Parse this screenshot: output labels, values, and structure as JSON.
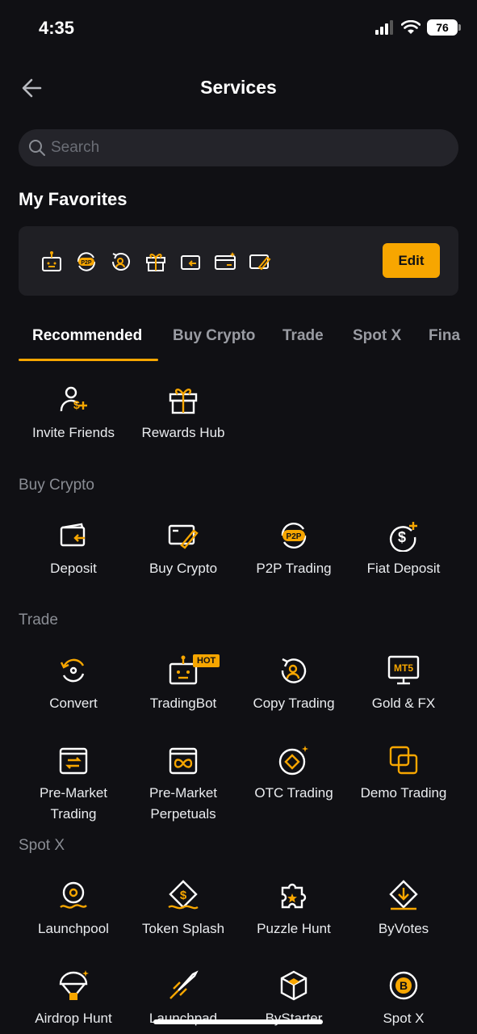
{
  "status_bar": {
    "time": "4:35",
    "battery": "76"
  },
  "header": {
    "title": "Services"
  },
  "search": {
    "placeholder": "Search"
  },
  "favorites": {
    "title": "My Favorites",
    "edit_label": "Edit",
    "icons": [
      "tradingbot-icon",
      "p2p-icon",
      "copy-trading-icon",
      "gift-icon",
      "deposit-icon",
      "card-icon",
      "buy-crypto-icon"
    ]
  },
  "tabs": [
    "Recommended",
    "Buy Crypto",
    "Trade",
    "Spot X",
    "Fina"
  ],
  "recommended": {
    "items": [
      {
        "label": "Invite Friends",
        "icon": "invite-friends-icon"
      },
      {
        "label": "Rewards Hub",
        "icon": "gift-icon"
      }
    ]
  },
  "buy_crypto": {
    "title": "Buy Crypto",
    "items": [
      {
        "label": "Deposit",
        "icon": "deposit-icon"
      },
      {
        "label": "Buy Crypto",
        "icon": "buy-crypto-icon"
      },
      {
        "label": "P2P Trading",
        "icon": "p2p-icon"
      },
      {
        "label": "Fiat Deposit",
        "icon": "fiat-deposit-icon"
      }
    ]
  },
  "trade": {
    "title": "Trade",
    "items": [
      {
        "label": "Convert",
        "icon": "convert-icon"
      },
      {
        "label": "TradingBot",
        "icon": "tradingbot-icon",
        "badge": "HOT"
      },
      {
        "label": "Copy Trading",
        "icon": "copy-trading-icon"
      },
      {
        "label": "Gold & FX",
        "icon": "mt5-icon"
      },
      {
        "label_line1": "Pre-Market",
        "label_line2": "Trading",
        "icon": "pre-market-trading-icon"
      },
      {
        "label_line1": "Pre-Market",
        "label_line2": "Perpetuals",
        "icon": "pre-market-perpetuals-icon"
      },
      {
        "label": "OTC Trading",
        "icon": "otc-trading-icon"
      },
      {
        "label": "Demo Trading",
        "icon": "demo-trading-icon"
      }
    ]
  },
  "spot_x": {
    "title": "Spot X",
    "items": [
      {
        "label": "Launchpool",
        "icon": "launchpool-icon"
      },
      {
        "label": "Token Splash",
        "icon": "token-splash-icon"
      },
      {
        "label": "Puzzle Hunt",
        "icon": "puzzle-icon"
      },
      {
        "label": "ByVotes",
        "icon": "byvotes-icon"
      },
      {
        "label": "Airdrop Hunt",
        "icon": "airdrop-icon"
      },
      {
        "label": "Launchpad",
        "icon": "launchpad-icon"
      },
      {
        "label": "ByStarter",
        "icon": "bystarter-icon"
      },
      {
        "label": "Spot X",
        "icon": "spot-x-icon"
      }
    ]
  },
  "colors": {
    "accent": "#f7a600",
    "background": "#101014",
    "panel": "#1f1f24"
  }
}
